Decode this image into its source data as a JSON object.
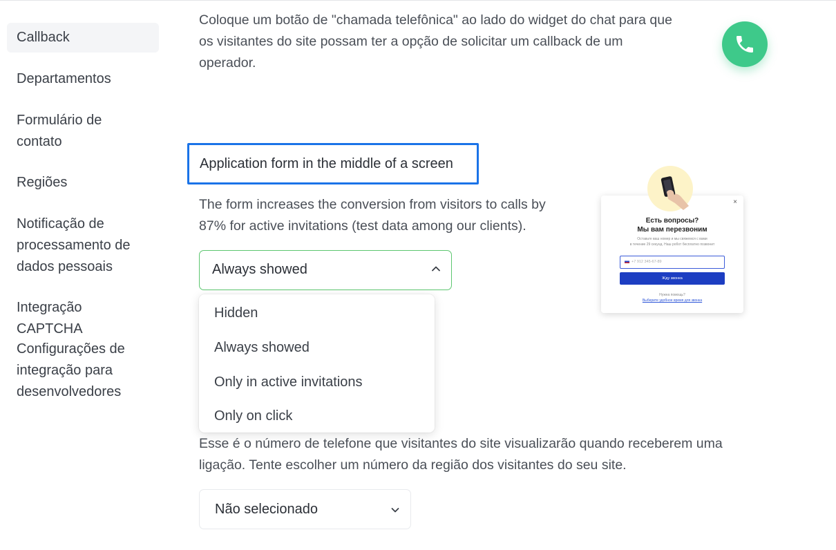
{
  "sidebar": {
    "items": [
      {
        "label": "Callback",
        "active": true
      },
      {
        "label": "Departamentos"
      },
      {
        "label": "Formulário de contato"
      },
      {
        "label": "Regiões"
      },
      {
        "label": "Notificação de processamento de dados pessoais"
      },
      {
        "label": "Integração CAPTCHA"
      },
      {
        "label": "Configurações de integração para desenvolvedores"
      }
    ]
  },
  "main": {
    "intro_text": "Coloque um botão de \"chamada telefônica\" ao lado do widget do chat para que os visitantes do site possam ter a opção de solicitar um callback de um operador.",
    "phone_button_icon": "phone-icon",
    "accent_color": "#3ec98a",
    "form_section": {
      "title": "Application form in the middle of a screen",
      "description": "The form increases the conversion from visitors to calls by 87% for active invitations (test data among our clients).",
      "select_value": "Always showed",
      "options": [
        "Hidden",
        "Always showed",
        "Only in active invitations",
        "Only on click"
      ]
    },
    "phone_section": {
      "description": "Esse é o número de telefone que visitantes do site visualizarão quando receberem uma ligação. Tente escolher um número da região dos visitantes do seu site.",
      "select_value": "Não selecionado"
    },
    "preview": {
      "close": "×",
      "title_line1": "Есть вопросы?",
      "title_line2": "Мы вам перезвоним",
      "desc_line1": "Оставьте ваш номер и мы свяжемся с вами",
      "desc_line2": "в течение 29 секунд. Наш робот бесплатно позвонит",
      "phone_prefix": "+7",
      "phone_placeholder": "912 345-67-89",
      "button": "Жду звонка",
      "foot_text": "Нужна помощь?",
      "foot_link": "Выберите удобное время для звонка"
    }
  }
}
